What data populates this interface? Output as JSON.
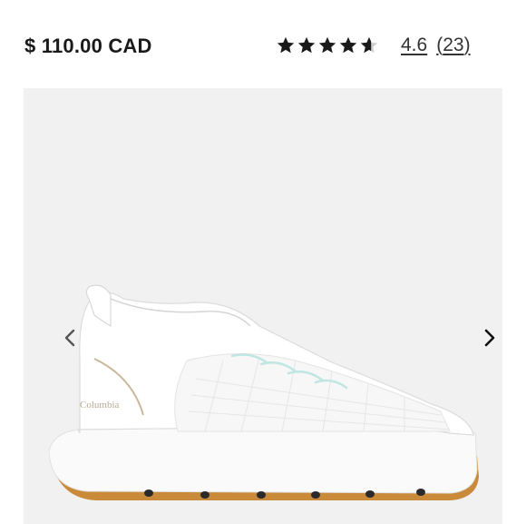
{
  "product": {
    "price": "$ 110.00 CAD",
    "rating": {
      "stars_value": 4.6,
      "stars_max": 5,
      "value_label": "4.6",
      "review_count": "23"
    },
    "image": {
      "brand_mark_text": "Columbia",
      "description_icon": "sneaker-image"
    }
  },
  "gallery": {
    "prev_icon": "chevron-left-icon",
    "next_icon": "chevron-right-icon"
  },
  "colors": {
    "star": "#1a1a1a",
    "gallery_bg": "#f1f1f1",
    "sole_gum": "#c98a3a"
  }
}
